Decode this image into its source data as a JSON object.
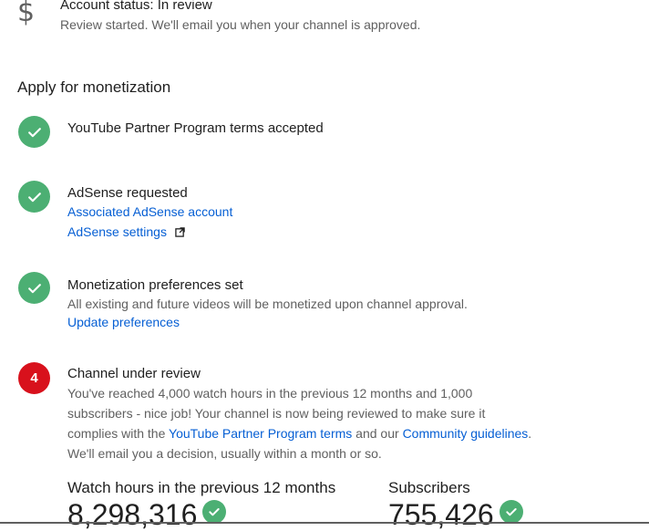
{
  "account_status": {
    "icon": "dollar-icon",
    "symbol": "$",
    "title": "Account status: In review",
    "subtitle": "Review started. We'll email you when your channel is approved."
  },
  "section_title": "Apply for monetization",
  "colors": {
    "success": "#4caf73",
    "alert": "#d8111c",
    "link": "#065fd4"
  },
  "steps": [
    {
      "state": "done",
      "icon": "check-icon",
      "title": "YouTube Partner Program terms accepted"
    },
    {
      "state": "done",
      "icon": "check-icon",
      "title": "AdSense requested",
      "links": [
        {
          "label": "Associated AdSense account"
        },
        {
          "label": "AdSense settings",
          "icon": "external-link-icon"
        }
      ]
    },
    {
      "state": "done",
      "icon": "check-icon",
      "title": "Monetization preferences set",
      "text": "All existing and future videos will be monetized upon channel approval.",
      "link": "Update preferences"
    },
    {
      "state": "in-review",
      "number": "4",
      "title": "Channel under review",
      "text_line1": "You've reached 4,000 watch hours in the previous 12 months and 1,000",
      "text_line2": "subscribers - nice job! Your channel is now being reviewed to make sure it",
      "text_line3_a": "complies with the ",
      "link_terms": "YouTube Partner Program terms",
      "text_line3_b": " and our ",
      "link_guidelines": "Community guidelines",
      "text_line3_c": ".",
      "text_line4": "We'll email you a decision, usually within a month or so."
    }
  ],
  "metrics": {
    "watch_hours": {
      "label": "Watch hours in the previous 12 months",
      "value": "8,298,316",
      "icon": "check-icon"
    },
    "subscribers": {
      "label": "Subscribers",
      "value": "755,426",
      "icon": "check-icon"
    }
  }
}
